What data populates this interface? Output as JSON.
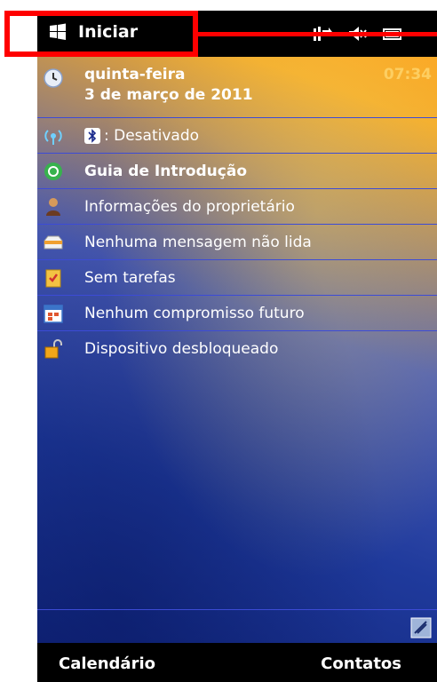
{
  "topbar": {
    "title": "Iniciar",
    "icons": [
      "windows-logo-icon",
      "connectivity-icon",
      "volume-muted-icon",
      "battery-icon"
    ]
  },
  "today": {
    "date_row": {
      "day": "quinta-feira",
      "date": "3 de março de 2011",
      "time": "07:34",
      "icon": "clock-icon"
    },
    "items": [
      {
        "icon": "wireless-icon",
        "prefix_icon": "bluetooth-icon",
        "label": ": Desativado"
      },
      {
        "icon": "getting-started-icon",
        "label": "Guia de Introdução"
      },
      {
        "icon": "owner-icon",
        "label": "Informações do proprietário"
      },
      {
        "icon": "inbox-icon",
        "label": "Nenhuma mensagem não lida"
      },
      {
        "icon": "tasks-icon",
        "label": "Sem tarefas"
      },
      {
        "icon": "calendar-icon",
        "label": "Nenhum compromisso futuro"
      },
      {
        "icon": "lock-icon",
        "label": "Dispositivo desbloqueado"
      }
    ]
  },
  "softkeys": {
    "left": "Calendário",
    "right": "Contatos"
  },
  "colors": {
    "highlight": "#ff0000",
    "row_divider": "#3c4bd6",
    "bar": "#000000"
  }
}
